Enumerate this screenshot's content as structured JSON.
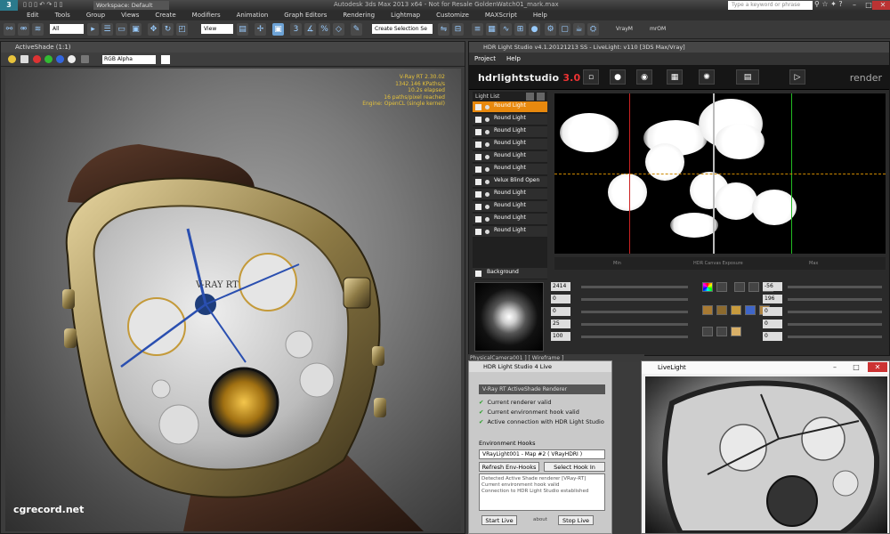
{
  "app": {
    "window_title": "Autodesk 3ds Max 2013 x64 - Not for Resale  GoldenWatch01_mark.max",
    "workspace": "Workspace: Default",
    "search_placeholder": "Type a keyword or phrase"
  },
  "menubar": [
    "Edit",
    "Tools",
    "Group",
    "Views",
    "Create",
    "Modifiers",
    "Animation",
    "Graph Editors",
    "Rendering",
    "Lightmap",
    "Customize",
    "MAXScript",
    "Help"
  ],
  "toolbar": {
    "filter_select": "All",
    "view_select": "View",
    "selection_set": "Create Selection Se",
    "vray_label": "VrayM",
    "mr_label": "mrOM"
  },
  "activeshade": {
    "title": "ActiveShade (1:1)",
    "channel": "RGB Alpha",
    "stats": [
      "V-Ray RT 2.30.02",
      "1342.146 KPaths/s",
      "10.2s elapsed",
      "16 paths/pixel reached",
      "Engine: OpenCL (single kernel)"
    ],
    "watch_brand": "V-RAY RT"
  },
  "watermark": "cgrecord.net",
  "hdr": {
    "title": "HDR Light Studio v4.1.20121213 SS - LiveLight: v110 [3DS Max/Vray]",
    "menu": [
      "Project",
      "Help"
    ],
    "logo_main": "hdrlightstudio",
    "logo_suffix": "3.0",
    "render_label": "render",
    "light_list_title": "Light List",
    "lights": [
      {
        "name": "Round Light",
        "selected": true
      },
      {
        "name": "Round Light",
        "selected": false
      },
      {
        "name": "Round Light",
        "selected": false
      },
      {
        "name": "Round Light",
        "selected": false
      },
      {
        "name": "Round Light",
        "selected": false
      },
      {
        "name": "Round Light",
        "selected": false
      },
      {
        "name": "Velux Blind Open",
        "selected": false
      },
      {
        "name": "Round Light",
        "selected": false
      },
      {
        "name": "Round Light",
        "selected": false
      },
      {
        "name": "Round Light",
        "selected": false
      },
      {
        "name": "Round Light",
        "selected": false
      }
    ],
    "background_label": "Background",
    "canvas_bottom": [
      "Min",
      "HDR Canvas Exposure",
      "Max"
    ],
    "values": [
      "2414",
      "0",
      "0",
      "25",
      "100"
    ],
    "values_right": [
      "-56",
      "196",
      "0",
      "0",
      "0"
    ]
  },
  "camstrip": "PhysicalCamera001 ] [ Wireframe ]",
  "live": {
    "title": "HDR Light Studio 4 Live",
    "renderer_header": "V-Ray RT ActiveShade Renderer",
    "status": [
      "Current renderer valid",
      "Current environment hook valid",
      "Active connection with HDR Light Studio"
    ],
    "env_hooks_label": "Environment Hooks",
    "env_select": "VRayLight001 - Map #2  ( VRayHDRI )",
    "refresh_button": "Refresh Env-Hooks",
    "select_hook_button": "Select Hook In Scene",
    "log": [
      "Detected Active Shade renderer [VRay-RT]",
      "Current environment hook valid",
      "Connection to HDR Light Studio established"
    ],
    "start_button": "Start Live",
    "stop_button": "Stop Live",
    "about": "about"
  },
  "livelight": {
    "title": "LiveLight"
  }
}
